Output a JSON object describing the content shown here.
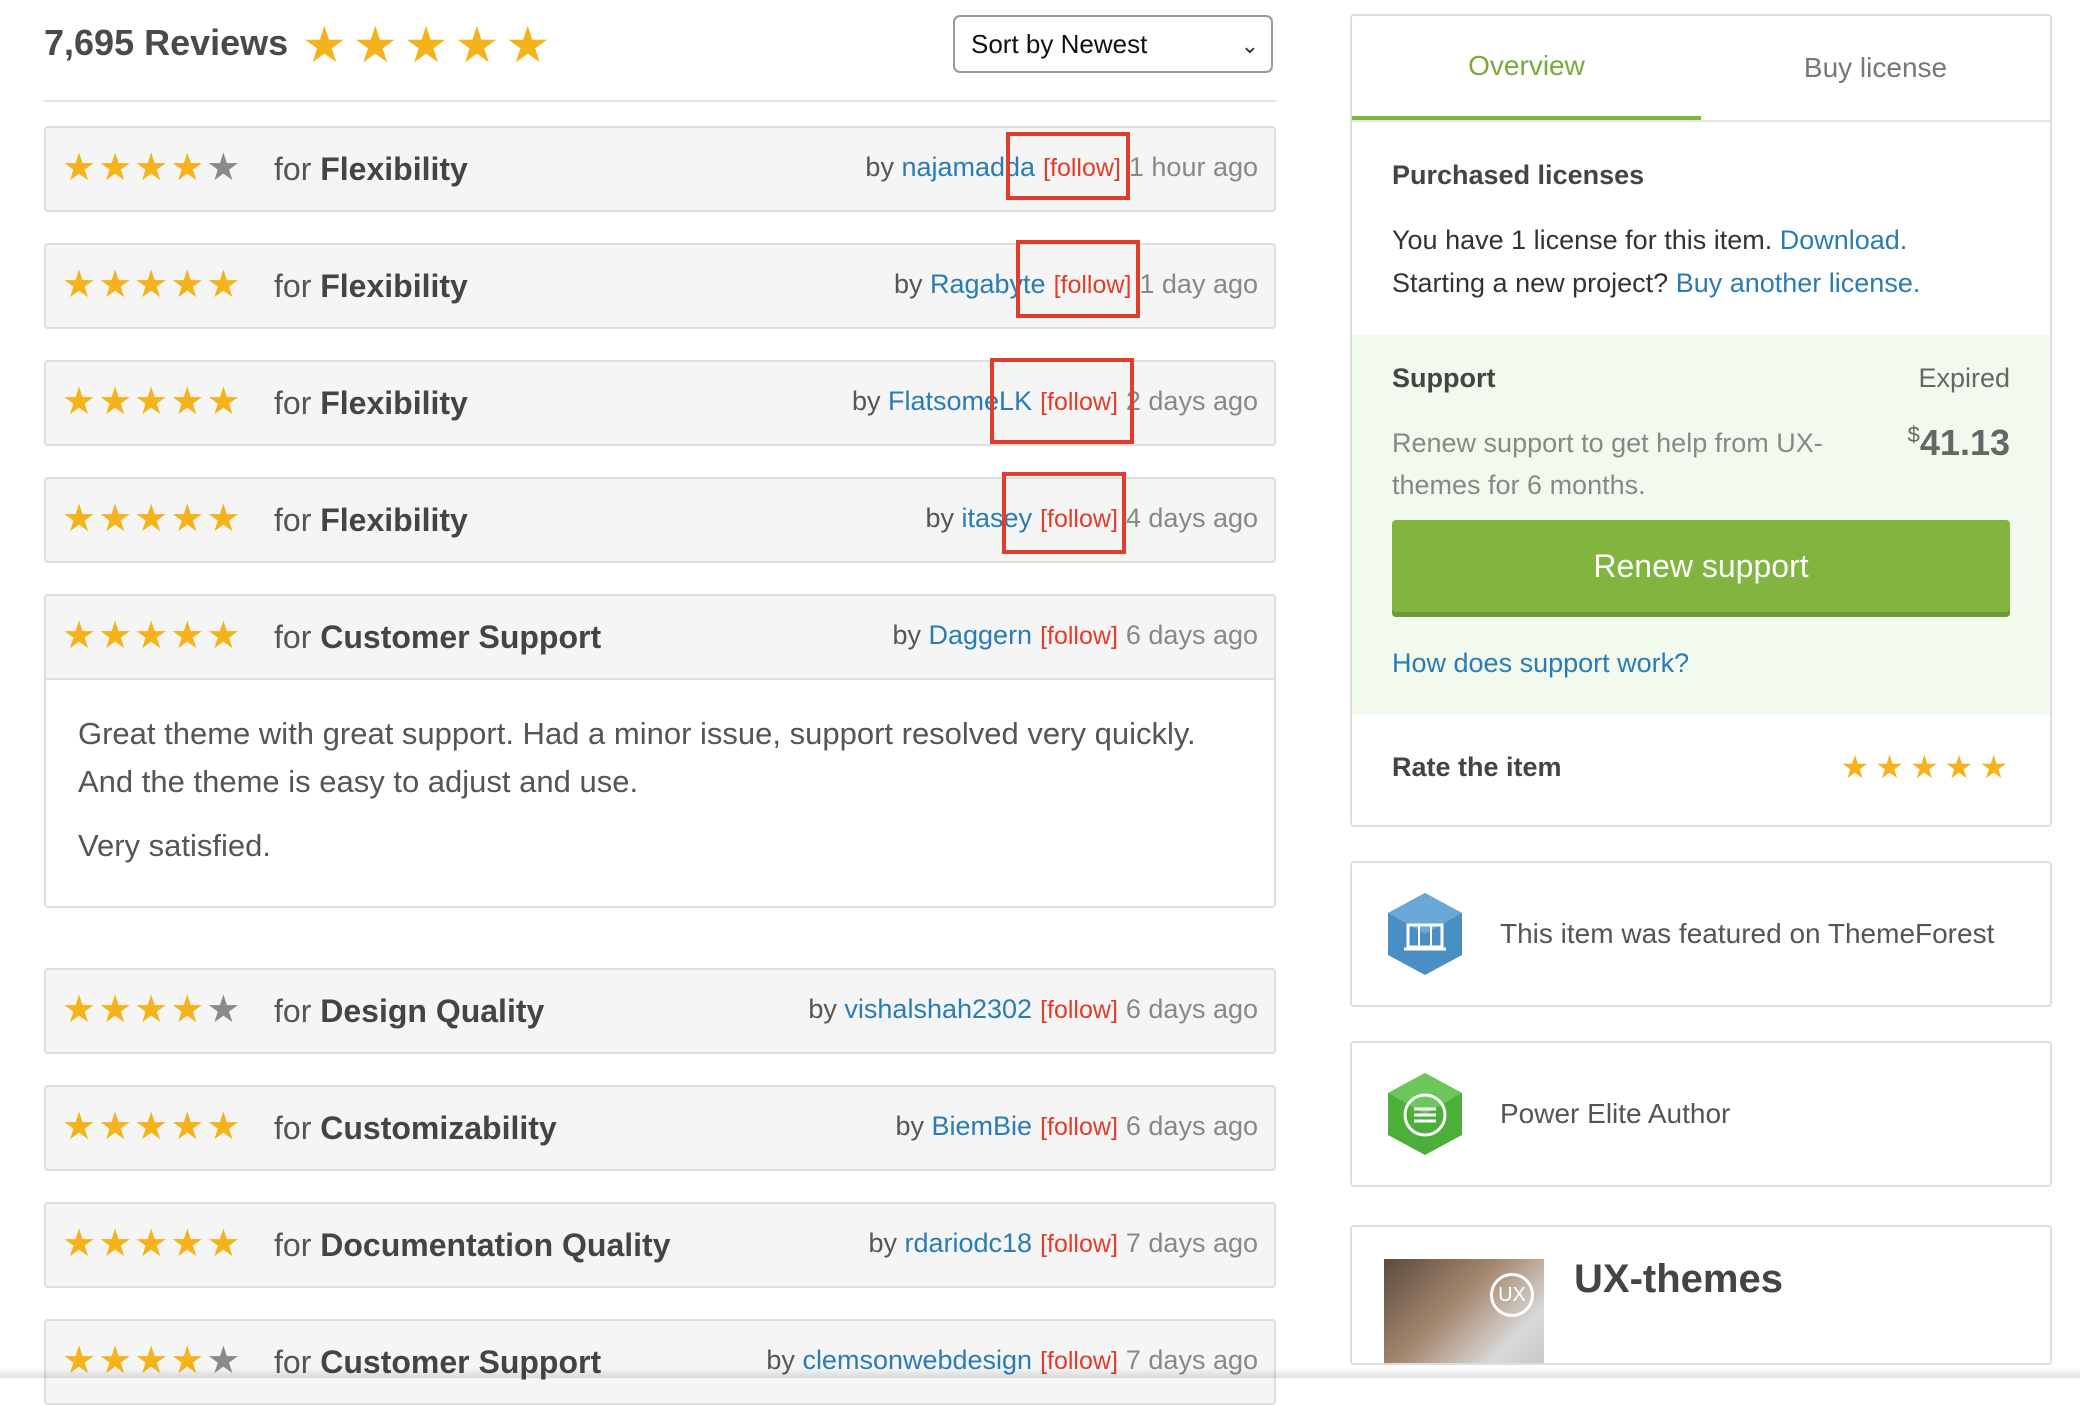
{
  "header": {
    "reviews_title": "7,695 Reviews",
    "overall_stars": 5,
    "sort_selected": "Sort by Newest"
  },
  "reviews": [
    {
      "stars": 4,
      "for_label": "for",
      "category": "Flexibility",
      "by": "by",
      "user": "najamadda",
      "follow": "[follow]",
      "ago": "1 hour ago"
    },
    {
      "stars": 5,
      "for_label": "for",
      "category": "Flexibility",
      "by": "by",
      "user": "Ragabyte",
      "follow": "[follow]",
      "ago": "1 day ago"
    },
    {
      "stars": 5,
      "for_label": "for",
      "category": "Flexibility",
      "by": "by",
      "user": "FlatsomeLK",
      "follow": "[follow]",
      "ago": "2 days ago"
    },
    {
      "stars": 5,
      "for_label": "for",
      "category": "Flexibility",
      "by": "by",
      "user": "itasey",
      "follow": "[follow]",
      "ago": "4 days ago"
    },
    {
      "stars": 5,
      "for_label": "for",
      "category": "Customer Support",
      "by": "by",
      "user": "Daggern",
      "follow": "[follow]",
      "ago": "6 days ago",
      "body": [
        "Great theme with great support. Had a minor issue, support resolved very quickly. And the theme is easy to adjust and use.",
        "Very satisfied."
      ]
    },
    {
      "stars": 4,
      "for_label": "for",
      "category": "Design Quality",
      "by": "by",
      "user": "vishalshah2302",
      "follow": "[follow]",
      "ago": "6 days ago"
    },
    {
      "stars": 5,
      "for_label": "for",
      "category": "Customizability",
      "by": "by",
      "user": "BiemBie",
      "follow": "[follow]",
      "ago": "6 days ago"
    },
    {
      "stars": 5,
      "for_label": "for",
      "category": "Documentation Quality",
      "by": "by",
      "user": "rdariodc18",
      "follow": "[follow]",
      "ago": "7 days ago"
    },
    {
      "stars": 4,
      "for_label": "for",
      "category": "Customer Support",
      "by": "by",
      "user": "clemsonwebdesign",
      "follow": "[follow]",
      "ago": "7 days ago"
    }
  ],
  "sidebar": {
    "tabs": [
      "Overview",
      "Buy license"
    ],
    "purchased_title": "Purchased licenses",
    "license_text": "You have 1 license for this item.",
    "download_link": "Download.",
    "new_project_text": "Starting a new project?",
    "buy_another_link": "Buy another license.",
    "support_title": "Support",
    "support_status": "Expired",
    "renew_text": "Renew support to get help from UX-themes for 6 months.",
    "price_currency": "$",
    "price_value": "41.13",
    "renew_button": "Renew support",
    "support_link": "How does support work?",
    "rate_title": "Rate the item",
    "featured_text": "This item was featured on ThemeForest",
    "elite_text": "Power Elite Author",
    "author_initials": "UX",
    "author_name": "UX-themes"
  },
  "colors": {
    "star": "#f5b21a",
    "link": "#2a7cb5",
    "follow": "#e23c2b",
    "accent_green": "#82b440"
  }
}
